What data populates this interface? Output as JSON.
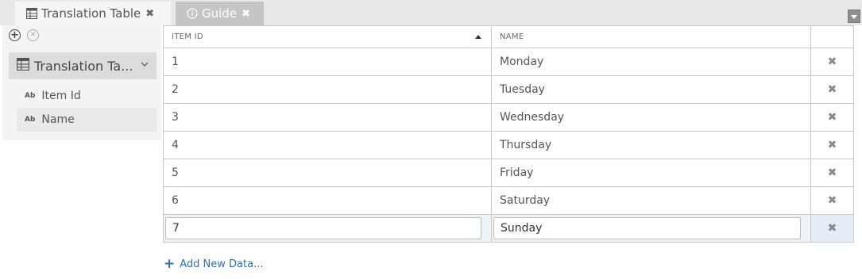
{
  "tabs": [
    {
      "label": "Translation Table",
      "icon": "table-icon",
      "active": true
    },
    {
      "label": "Guide",
      "icon": "info-icon",
      "active": false
    }
  ],
  "sidebar": {
    "root": {
      "label": "Translation Ta...",
      "icon": "table-icon"
    },
    "fields": [
      {
        "label": "Item Id",
        "type_badge": "Ab"
      },
      {
        "label": "Name",
        "type_badge": "Ab"
      }
    ]
  },
  "grid": {
    "columns": [
      "ITEM ID",
      "NAME"
    ],
    "sort": {
      "column": "ITEM ID",
      "direction": "ascending"
    },
    "rows": [
      {
        "item_id": "1",
        "name": "Monday"
      },
      {
        "item_id": "2",
        "name": "Tuesday"
      },
      {
        "item_id": "3",
        "name": "Wednesday"
      },
      {
        "item_id": "4",
        "name": "Thursday"
      },
      {
        "item_id": "5",
        "name": "Friday"
      },
      {
        "item_id": "6",
        "name": "Saturday"
      },
      {
        "item_id": "7",
        "name": "Sunday",
        "editing": true
      }
    ]
  },
  "actions": {
    "add_new": "Add New Data..."
  },
  "colors": {
    "link": "#2a6eb8",
    "tab_active": "#f5f5f5",
    "tab_inactive": "#c5c5c5",
    "editing_row": "#eef3f8"
  }
}
